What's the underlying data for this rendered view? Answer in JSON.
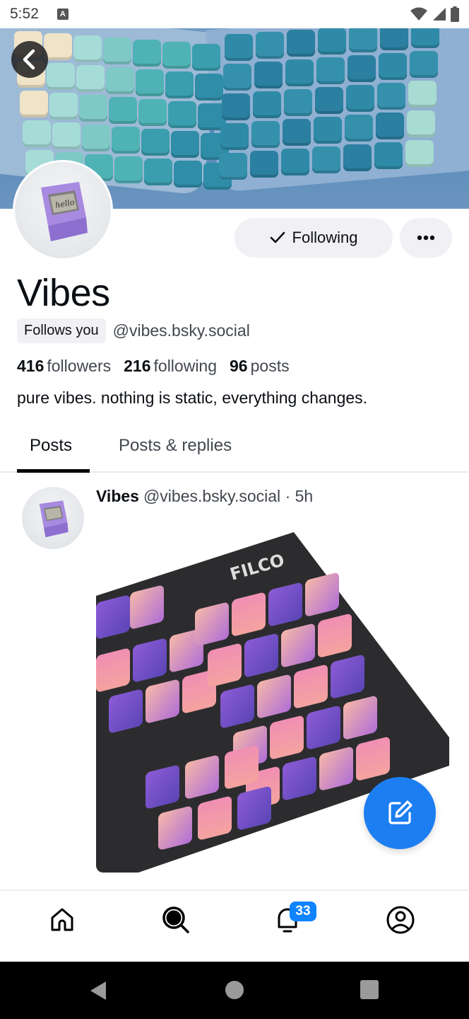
{
  "status_bar": {
    "time": "5:52",
    "notification_icon": "a-icon",
    "icons": [
      "wifi-icon",
      "signal-icon",
      "battery-icon"
    ]
  },
  "profile": {
    "banner_alt": "mechanical keyboard banner",
    "display_name": "Vibes",
    "follows_you_label": "Follows you",
    "handle": "@vibes.bsky.social",
    "stats": {
      "followers_count": "416",
      "followers_label": "followers",
      "following_count": "216",
      "following_label": "following",
      "posts_count": "96",
      "posts_label": "posts"
    },
    "bio": "pure vibes. nothing is static, everything changes.",
    "following_button_label": "Following",
    "more_button": "more-icon"
  },
  "tabs": [
    {
      "label": "Posts",
      "active": true
    },
    {
      "label": "Posts & replies",
      "active": false
    }
  ],
  "post": {
    "author_name": "Vibes",
    "author_handle": "@vibes.bsky.social",
    "separator": "·",
    "time": "5h",
    "image_alt": "FILCO keyboard with purple pink keycaps",
    "image_brand_text": "FILCO"
  },
  "fab": {
    "icon": "compose-icon"
  },
  "bottom_nav": {
    "items": [
      "home-icon",
      "search-icon",
      "notifications-icon",
      "profile-icon"
    ],
    "notifications_badge": "33",
    "accent": "#1083fe"
  },
  "system_nav": [
    "back",
    "home",
    "recents"
  ]
}
